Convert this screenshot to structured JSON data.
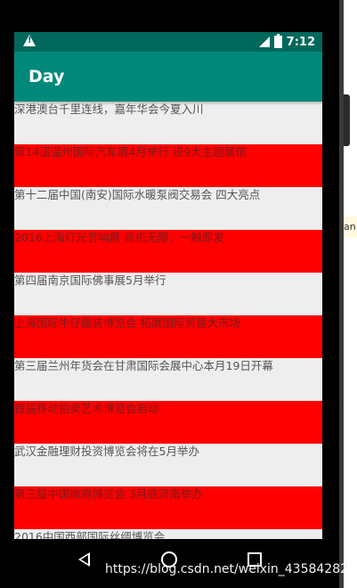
{
  "status_bar": {
    "time": "7:12",
    "icons": [
      "warning-icon",
      "signal-icon",
      "battery-icon"
    ]
  },
  "app_bar": {
    "title": "Day"
  },
  "list": {
    "items": [
      {
        "text": "深港澳台千里连线，嘉年华会今夏入川",
        "style": "gray"
      },
      {
        "text": "第14届温州国际汽车展4月举行 设9大主题展馆",
        "style": "red"
      },
      {
        "text": "第十二届中国(南安)国际水暖泵阀交易会 四大亮点",
        "style": "gray"
      },
      {
        "text": "2016上海灯光音响展 商机无限，一触即发",
        "style": "red"
      },
      {
        "text": "第四届南京国际佛事展5月举行",
        "style": "gray"
      },
      {
        "text": "上海国际牛仔服装博览会 拓展国际贸易大市场",
        "style": "red"
      },
      {
        "text": "第三届兰州年货会在甘肃国际会展中心本月19日开幕",
        "style": "gray"
      },
      {
        "text": "首届移动拍卖艺术博览会启动",
        "style": "red"
      },
      {
        "text": "武汉金融理财投资博览会将在5月举办",
        "style": "gray"
      },
      {
        "text": "第三届中国微商博览会 3月底济南举办",
        "style": "red"
      },
      {
        "text": "2016中国西部国际丝绸博览会",
        "style": "gray"
      }
    ]
  },
  "cropped_side_text": "an",
  "watermark": "https://blog.csdn.net/weixin_43584282",
  "colors": {
    "status_bar": "#00695c",
    "app_bar": "#00897b",
    "row_red": "#ff0000",
    "row_gray": "#eeeeee"
  }
}
